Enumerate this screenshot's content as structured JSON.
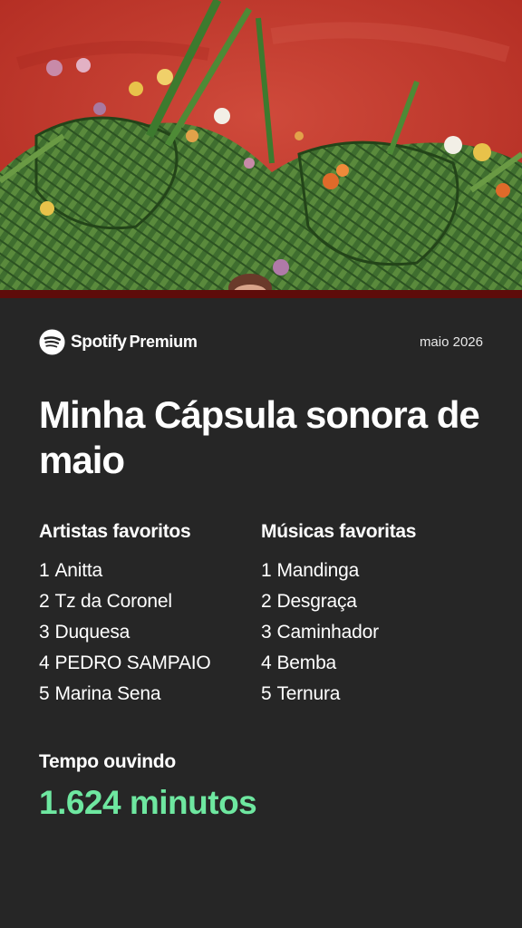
{
  "brand": {
    "name": "Spotify",
    "tier": "Premium",
    "accent_color": "#1DB954",
    "icon": "spotify-logo-icon"
  },
  "period": "maio 2026",
  "title": "Minha Cápsula sonora de maio",
  "artists": {
    "heading": "Artistas favoritos",
    "items": [
      {
        "rank": "1",
        "name": "Anitta"
      },
      {
        "rank": "2",
        "name": "Tz da Coronel"
      },
      {
        "rank": "3",
        "name": "Duquesa"
      },
      {
        "rank": "4",
        "name": "PEDRO SAMPAIO"
      },
      {
        "rank": "5",
        "name": "Marina Sena"
      }
    ]
  },
  "songs": {
    "heading": "Músicas favoritas",
    "items": [
      {
        "rank": "1",
        "name": "Mandinga"
      },
      {
        "rank": "2",
        "name": "Desgraça"
      },
      {
        "rank": "3",
        "name": "Caminhador"
      },
      {
        "rank": "4",
        "name": "Bemba"
      },
      {
        "rank": "5",
        "name": "Ternura"
      }
    ]
  },
  "listening": {
    "label": "Tempo ouvindo",
    "value": "1.624 minutos",
    "value_color": "#6EE7A0"
  },
  "colors": {
    "background": "#262626",
    "cover_red": "#C2372A",
    "cover_band": "#5E0C0A"
  }
}
